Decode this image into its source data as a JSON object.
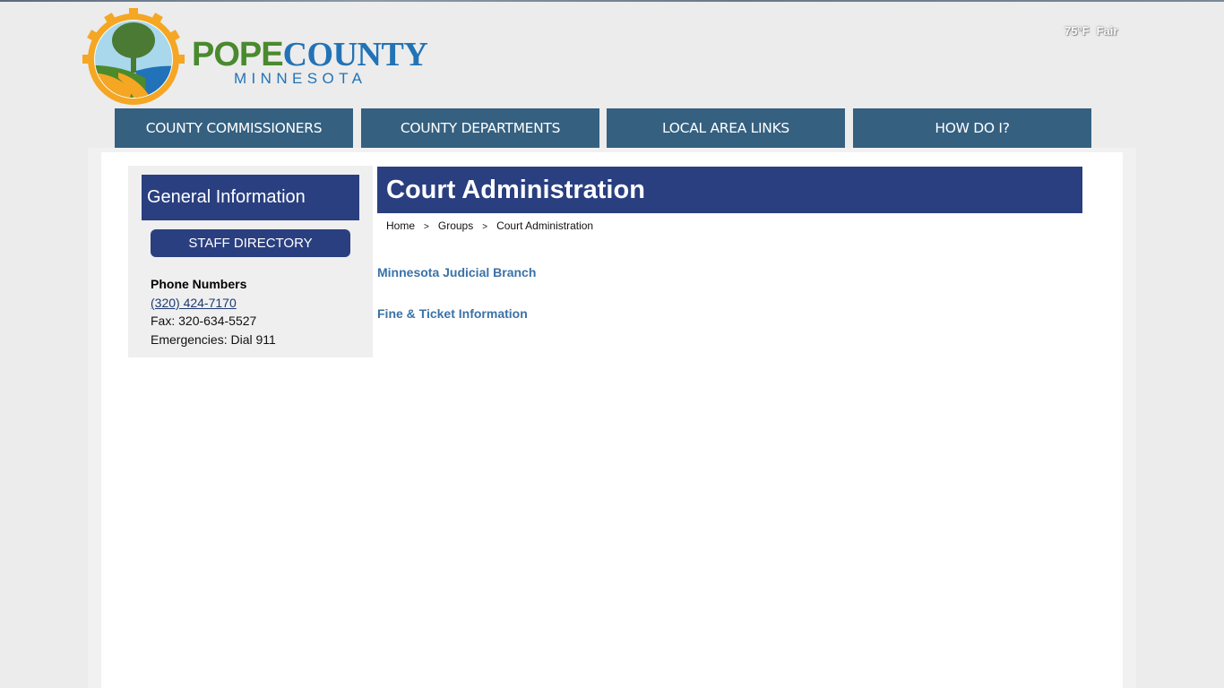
{
  "header": {
    "logo": {
      "title_part1": "POPE",
      "title_part2": "COUNTY",
      "subtitle": "MINNESOTA",
      "colors": {
        "green": "#4a8a2e",
        "blue": "#2273b6",
        "gold": "#f5a623"
      }
    },
    "weather": {
      "temperature": "75°F",
      "condition": "Fair"
    }
  },
  "nav": {
    "items": [
      {
        "label": "COUNTY COMMISSIONERS"
      },
      {
        "label": "COUNTY DEPARTMENTS"
      },
      {
        "label": "LOCAL AREA LINKS"
      },
      {
        "label": "HOW DO I?"
      }
    ],
    "color": "#356080"
  },
  "sidebar": {
    "header": "General Information",
    "staff_button": "STAFF DIRECTORY",
    "phone": {
      "title": "Phone Numbers",
      "main_number": "(320) 424-7170",
      "fax": "Fax: 320-634-5527",
      "emergency": "Emergencies: Dial 911"
    },
    "accent": "#2a3f80"
  },
  "main": {
    "title": "Court Administration",
    "breadcrumb": [
      {
        "label": "Home"
      },
      {
        "label": "Groups"
      },
      {
        "label": "Court Administration"
      }
    ],
    "breadcrumb_separator": ">",
    "links": [
      {
        "label": "Minnesota Judicial Branch"
      },
      {
        "label": "Fine & Ticket Information"
      }
    ],
    "link_color": "#3a72a8"
  }
}
